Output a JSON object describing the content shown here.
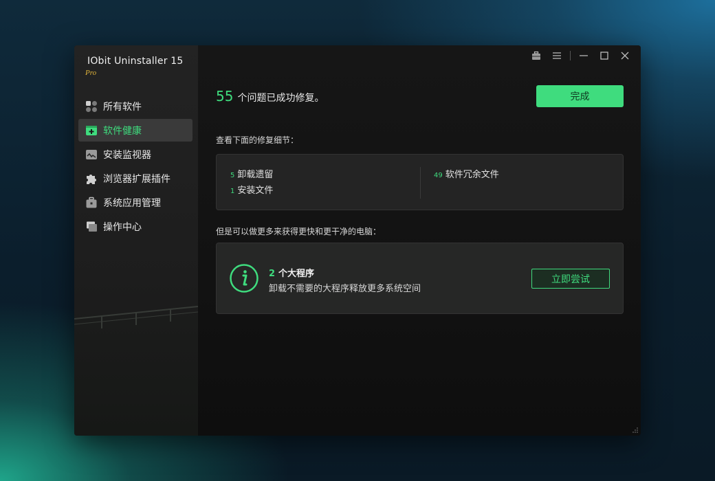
{
  "app": {
    "name": "IObit Uninstaller 15",
    "edition": "Pro"
  },
  "sidebar": {
    "items": [
      {
        "label": "所有软件",
        "icon": "grid-apps-icon",
        "active": false
      },
      {
        "label": "软件健康",
        "icon": "health-plus-icon",
        "active": true
      },
      {
        "label": "安装监视器",
        "icon": "monitor-icon",
        "active": false
      },
      {
        "label": "浏览器扩展插件",
        "icon": "puzzle-icon",
        "active": false
      },
      {
        "label": "系统应用管理",
        "icon": "briefcase-icon",
        "active": false
      },
      {
        "label": "操作中心",
        "icon": "flag-icon",
        "active": false
      }
    ]
  },
  "titlebar": {
    "icons": [
      "toolbox-icon",
      "menu-icon",
      "minimize-icon",
      "maximize-icon",
      "close-icon"
    ]
  },
  "summary": {
    "count": "55",
    "text": "个问题已成功修复。"
  },
  "done_button": "完成",
  "details": {
    "heading": "查看下面的修复细节：",
    "items": [
      {
        "count": "5",
        "label": "卸载遗留"
      },
      {
        "count": "1",
        "label": "安装文件"
      },
      {
        "count": "49",
        "label": "软件冗余文件"
      }
    ]
  },
  "promo": {
    "heading": "但是可以做更多来获得更快和更干净的电脑：",
    "count": "2",
    "title": "个大程序",
    "description": "卸载不需要的大程序释放更多系统空间",
    "button": "立即尝试",
    "icon": "info-circle-icon"
  },
  "colors": {
    "accent": "#3fdc7e",
    "edition": "#e0b33a",
    "window_bg": "#121212",
    "sidebar_bg": "#1f1f1f",
    "card_bg": "#242424"
  }
}
